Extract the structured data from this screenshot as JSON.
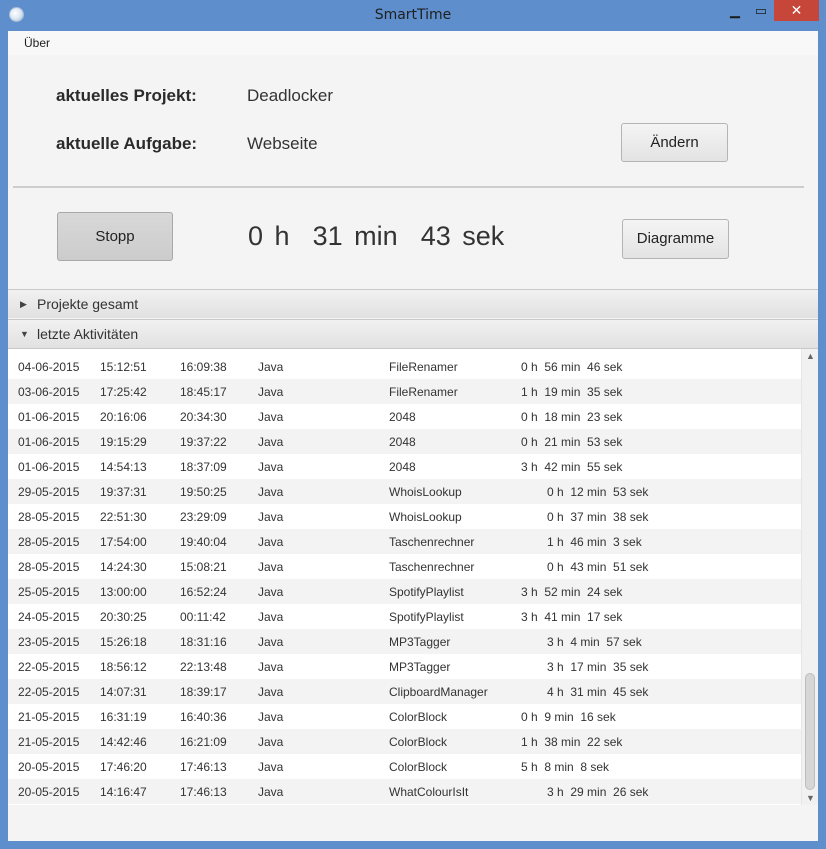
{
  "window": {
    "title": "SmartTime",
    "min_icon": "minimize-icon",
    "max_icon": "maximize-icon",
    "close_icon": "close-icon"
  },
  "menu": {
    "items": [
      "Über"
    ]
  },
  "project": {
    "label": "aktuelles Projekt:",
    "value": "Deadlocker",
    "task_label": "aktuelle Aufgabe:",
    "task_value": "Webseite",
    "change_button": "Ändern"
  },
  "timer": {
    "stop_button": "Stopp",
    "hours": "0",
    "hours_unit": "h",
    "minutes": "31",
    "minutes_unit": "min",
    "seconds": "43",
    "seconds_unit": "sek",
    "diagram_button": "Diagramme"
  },
  "sections": {
    "projects_total": "Projekte gesamt",
    "recent_activities": "letzte Aktivitäten"
  },
  "activities": [
    {
      "date": "04-06-2015",
      "start": "15:12:51",
      "end": "16:09:38",
      "category": "Java",
      "project": "FileRenamer",
      "duration": "0 h  56 min  46 sek"
    },
    {
      "date": "03-06-2015",
      "start": "17:25:42",
      "end": "18:45:17",
      "category": "Java",
      "project": "FileRenamer",
      "duration": "1 h  19 min  35 sek"
    },
    {
      "date": "01-06-2015",
      "start": "20:16:06",
      "end": "20:34:30",
      "category": "Java",
      "project": "2048",
      "duration": "0 h  18 min  23 sek"
    },
    {
      "date": "01-06-2015",
      "start": "19:15:29",
      "end": "19:37:22",
      "category": "Java",
      "project": "2048",
      "duration": "0 h  21 min  53 sek"
    },
    {
      "date": "01-06-2015",
      "start": "14:54:13",
      "end": "18:37:09",
      "category": "Java",
      "project": "2048",
      "duration": "3 h  42 min  55 sek"
    },
    {
      "date": "29-05-2015",
      "start": "19:37:31",
      "end": "19:50:25",
      "category": "Java",
      "project": "WhoisLookup",
      "duration": "0 h  12 min  53 sek"
    },
    {
      "date": "28-05-2015",
      "start": "22:51:30",
      "end": "23:29:09",
      "category": "Java",
      "project": "WhoisLookup",
      "duration": "0 h  37 min  38 sek"
    },
    {
      "date": "28-05-2015",
      "start": "17:54:00",
      "end": "19:40:04",
      "category": "Java",
      "project": "Taschenrechner",
      "duration": "1 h  46 min  3 sek"
    },
    {
      "date": "28-05-2015",
      "start": "14:24:30",
      "end": "15:08:21",
      "category": "Java",
      "project": "Taschenrechner",
      "duration": "0 h  43 min  51 sek"
    },
    {
      "date": "25-05-2015",
      "start": "13:00:00",
      "end": "16:52:24",
      "category": "Java",
      "project": "SpotifyPlaylist",
      "duration": "3 h  52 min  24 sek"
    },
    {
      "date": "24-05-2015",
      "start": "20:30:25",
      "end": "00:11:42",
      "category": "Java",
      "project": "SpotifyPlaylist",
      "duration": "3 h  41 min  17 sek"
    },
    {
      "date": "23-05-2015",
      "start": "15:26:18",
      "end": "18:31:16",
      "category": "Java",
      "project": "MP3Tagger",
      "duration": "3 h  4 min  57 sek"
    },
    {
      "date": "22-05-2015",
      "start": "18:56:12",
      "end": "22:13:48",
      "category": "Java",
      "project": "MP3Tagger",
      "duration": "3 h  17 min  35 sek"
    },
    {
      "date": "22-05-2015",
      "start": "14:07:31",
      "end": "18:39:17",
      "category": "Java",
      "project": "ClipboardManager",
      "duration": "4 h  31 min  45 sek"
    },
    {
      "date": "21-05-2015",
      "start": "16:31:19",
      "end": "16:40:36",
      "category": "Java",
      "project": "ColorBlock",
      "duration": "0 h  9 min  16 sek"
    },
    {
      "date": "21-05-2015",
      "start": "14:42:46",
      "end": "16:21:09",
      "category": "Java",
      "project": "ColorBlock",
      "duration": "1 h  38 min  22 sek"
    },
    {
      "date": "20-05-2015",
      "start": "17:46:20",
      "end": "17:46:13",
      "category": "Java",
      "project": "ColorBlock",
      "duration": "5 h  8 min  8 sek"
    },
    {
      "date": "20-05-2015",
      "start": "14:16:47",
      "end": "17:46:13",
      "category": "Java",
      "project": "WhatColourIsIt",
      "duration": "3 h  29 min  26 sek"
    }
  ]
}
